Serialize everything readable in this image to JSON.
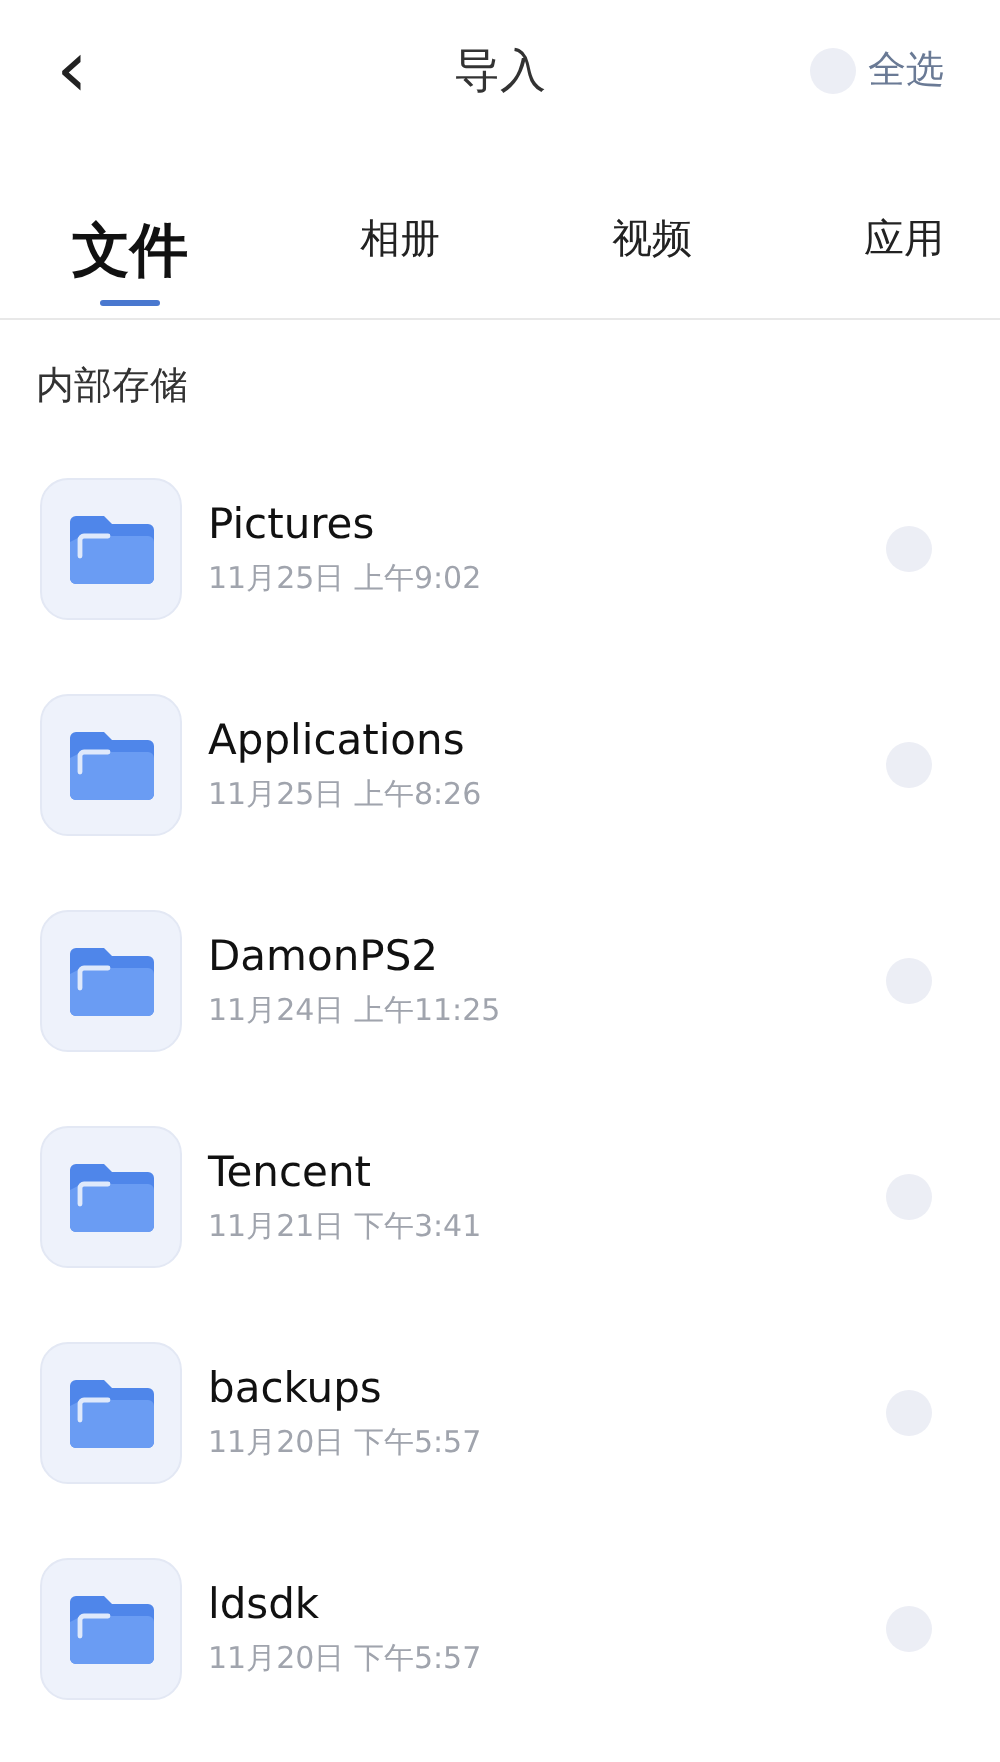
{
  "header": {
    "back": "‹",
    "title": "导入",
    "select_all": {
      "label": "全选",
      "checked": false
    }
  },
  "tabs": [
    {
      "label": "文件",
      "selected": true
    },
    {
      "label": "相册",
      "selected": false
    },
    {
      "label": "视频",
      "selected": false
    },
    {
      "label": "应用",
      "selected": false
    }
  ],
  "section": "内部存储",
  "items": [
    {
      "name": "Pictures",
      "date": "11月25日 上午9:02",
      "selected": false
    },
    {
      "name": "Applications",
      "date": "11月25日 上午8:26",
      "selected": false
    },
    {
      "name": "DamonPS2",
      "date": "11月24日 上午11:25",
      "selected": false
    },
    {
      "name": "Tencent",
      "date": "11月21日 下午3:41",
      "selected": false
    },
    {
      "name": "backups",
      "date": "11月20日 下午5:57",
      "selected": false
    },
    {
      "name": "ldsdk",
      "date": "11月20日 下午5:57",
      "selected": false
    }
  ]
}
